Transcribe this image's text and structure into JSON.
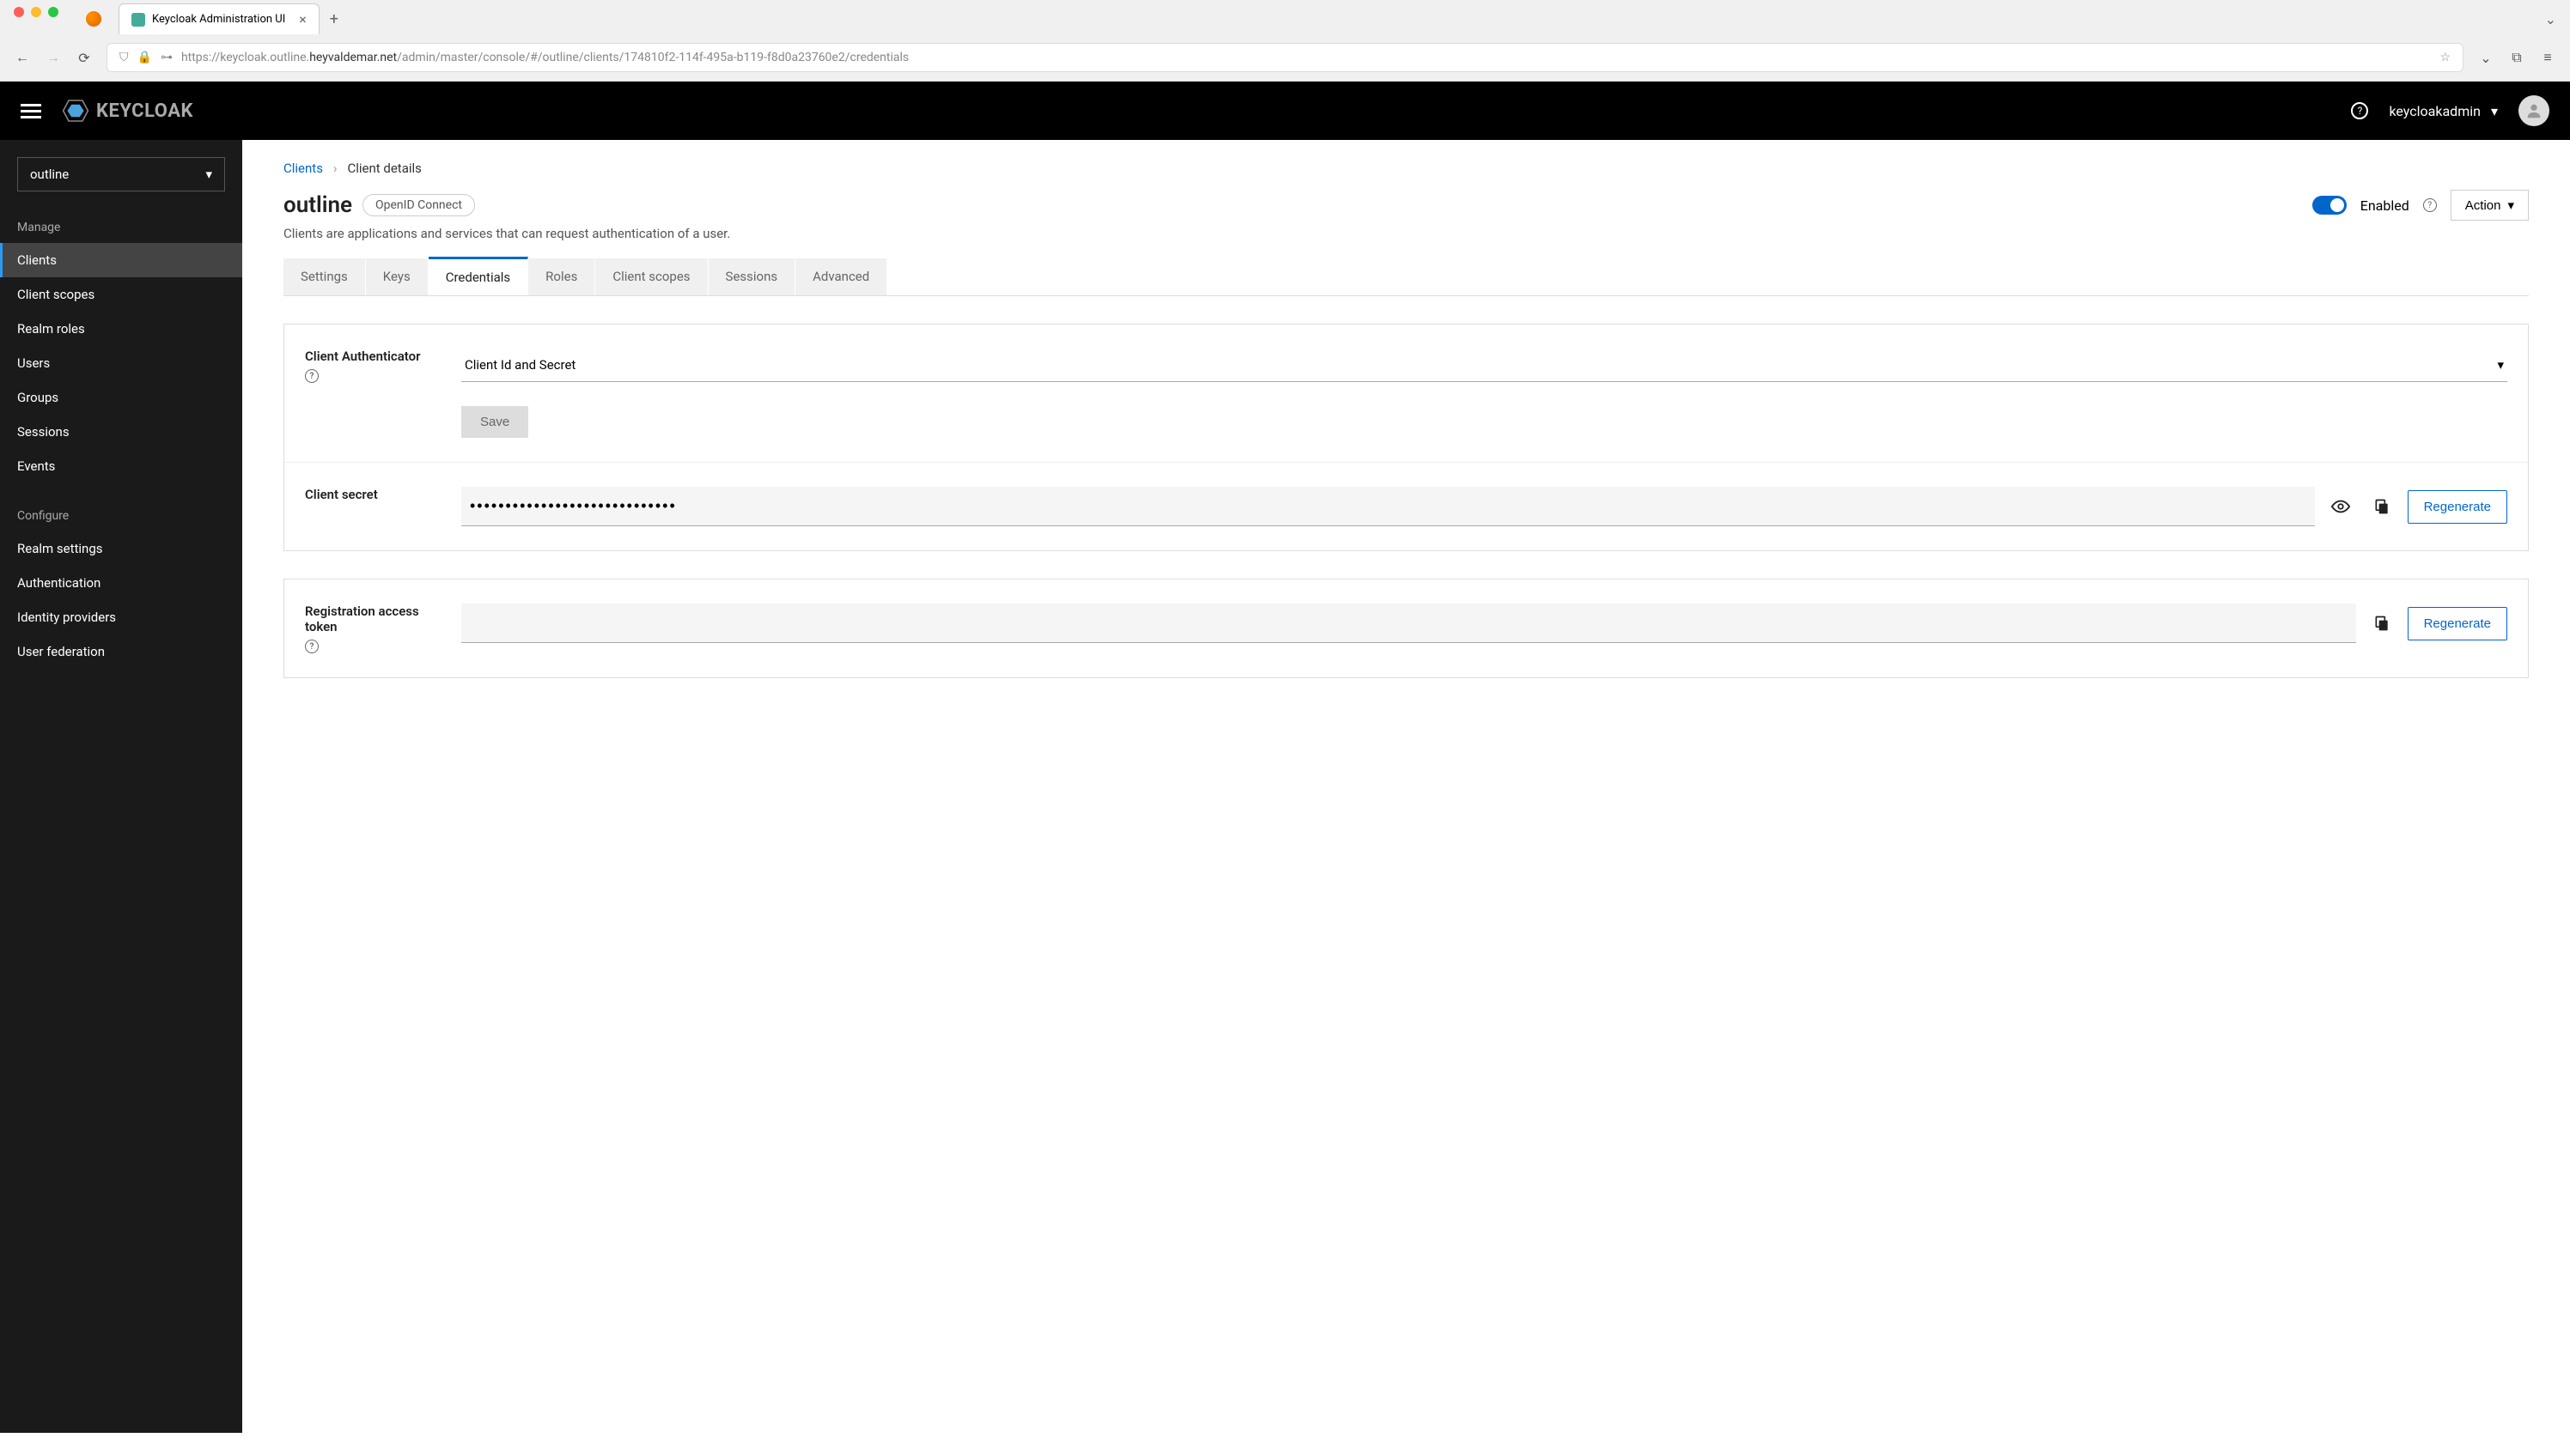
{
  "browser": {
    "tab_title": "Keycloak Administration UI",
    "url_prefix": "https://keycloak.outline.",
    "url_host": "heyvaldemar.net",
    "url_path": "/admin/master/console/#/outline/clients/174810f2-114f-495a-b119-f8d0a23760e2/credentials"
  },
  "header": {
    "brand": "KEYCLOAK",
    "username": "keycloakadmin"
  },
  "sidebar": {
    "realm": "outline",
    "section_manage": "Manage",
    "items_manage": [
      "Clients",
      "Client scopes",
      "Realm roles",
      "Users",
      "Groups",
      "Sessions",
      "Events"
    ],
    "section_configure": "Configure",
    "items_configure": [
      "Realm settings",
      "Authentication",
      "Identity providers",
      "User federation"
    ]
  },
  "breadcrumb": {
    "clients": "Clients",
    "current": "Client details"
  },
  "page": {
    "title": "outline",
    "badge": "OpenID Connect",
    "enabled_label": "Enabled",
    "action_label": "Action",
    "subtitle": "Clients are applications and services that can request authentication of a user."
  },
  "tabs": [
    "Settings",
    "Keys",
    "Credentials",
    "Roles",
    "Client scopes",
    "Sessions",
    "Advanced"
  ],
  "form": {
    "authenticator_label": "Client Authenticator",
    "authenticator_value": "Client Id and Secret",
    "save_label": "Save",
    "secret_label": "Client secret",
    "secret_value": "•••••••••••••••••••••••••••••",
    "regenerate_label": "Regenerate",
    "token_label": "Registration access token"
  }
}
